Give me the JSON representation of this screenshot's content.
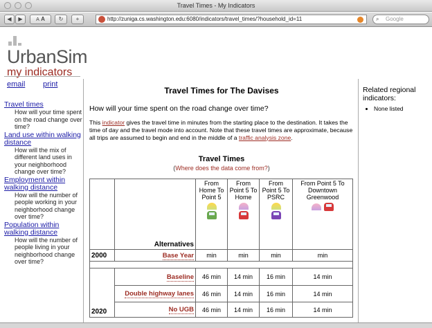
{
  "window": {
    "title": "Travel Times - My Indicators",
    "url": "http://zuniga.cs.washington.edu:6080/indicators/travel_times/?household_id=11",
    "search_placeholder": "Google",
    "font_small": "A",
    "font_large": "A"
  },
  "logo": {
    "name": "UrbanSim",
    "tagline": "my indicators"
  },
  "utility": {
    "email": "email",
    "print": "print"
  },
  "nav": [
    {
      "label": "Travel times",
      "desc": "How will your time spent on the road change over time?"
    },
    {
      "label": "Land use within walking distance",
      "desc": "How will the mix of different land uses in your neighborhood change over time?"
    },
    {
      "label": "Employment within walking distance",
      "desc": "How will the number of people working in your neighborhood change over time?"
    },
    {
      "label": "Population within walking distance",
      "desc": "How will the number of people living in your neighborhood change over time?"
    }
  ],
  "main": {
    "title": "Travel Times for The Davises",
    "question": "How will your time spent on the road change over time?",
    "intro_parts": {
      "p1": "This ",
      "link1": "indicator",
      "p2": " gives the travel time in minutes from the starting place to the destination. It takes the time of day and the travel mode into account. Note that these travel times are approximate, because all trips are assumed to begin and end in the middle of a ",
      "link2": "traffic analysis zone",
      "p3": "."
    },
    "table_title": "Travel Times",
    "table_sub_link": "Where does the data come from?",
    "table_sub_open": "(",
    "table_sub_close": ")"
  },
  "table": {
    "alternatives_label": "Alternatives",
    "columns": [
      {
        "label": "From Home To Point 5"
      },
      {
        "label": "From Point 5 To Home"
      },
      {
        "label": "From Point 5 To PSRC"
      },
      {
        "label": "From Point 5 To Downtown Greenwood"
      }
    ],
    "rows_2000": {
      "year": "2000",
      "alt": "Base Year",
      "values": [
        "min",
        "min",
        "min",
        "min"
      ]
    },
    "rows_2020": {
      "year": "2020",
      "rows": [
        {
          "alt": "Baseline",
          "values": [
            "46 min",
            "14 min",
            "16 min",
            "14 min"
          ]
        },
        {
          "alt": "Double highway lanes",
          "values": [
            "46 min",
            "14 min",
            "16 min",
            "14 min"
          ]
        },
        {
          "alt": "No UGB",
          "values": [
            "46 min",
            "14 min",
            "16 min",
            "14 min"
          ]
        }
      ]
    }
  },
  "right": {
    "heading": "Related regional indicators:",
    "items": [
      "None listed"
    ]
  }
}
